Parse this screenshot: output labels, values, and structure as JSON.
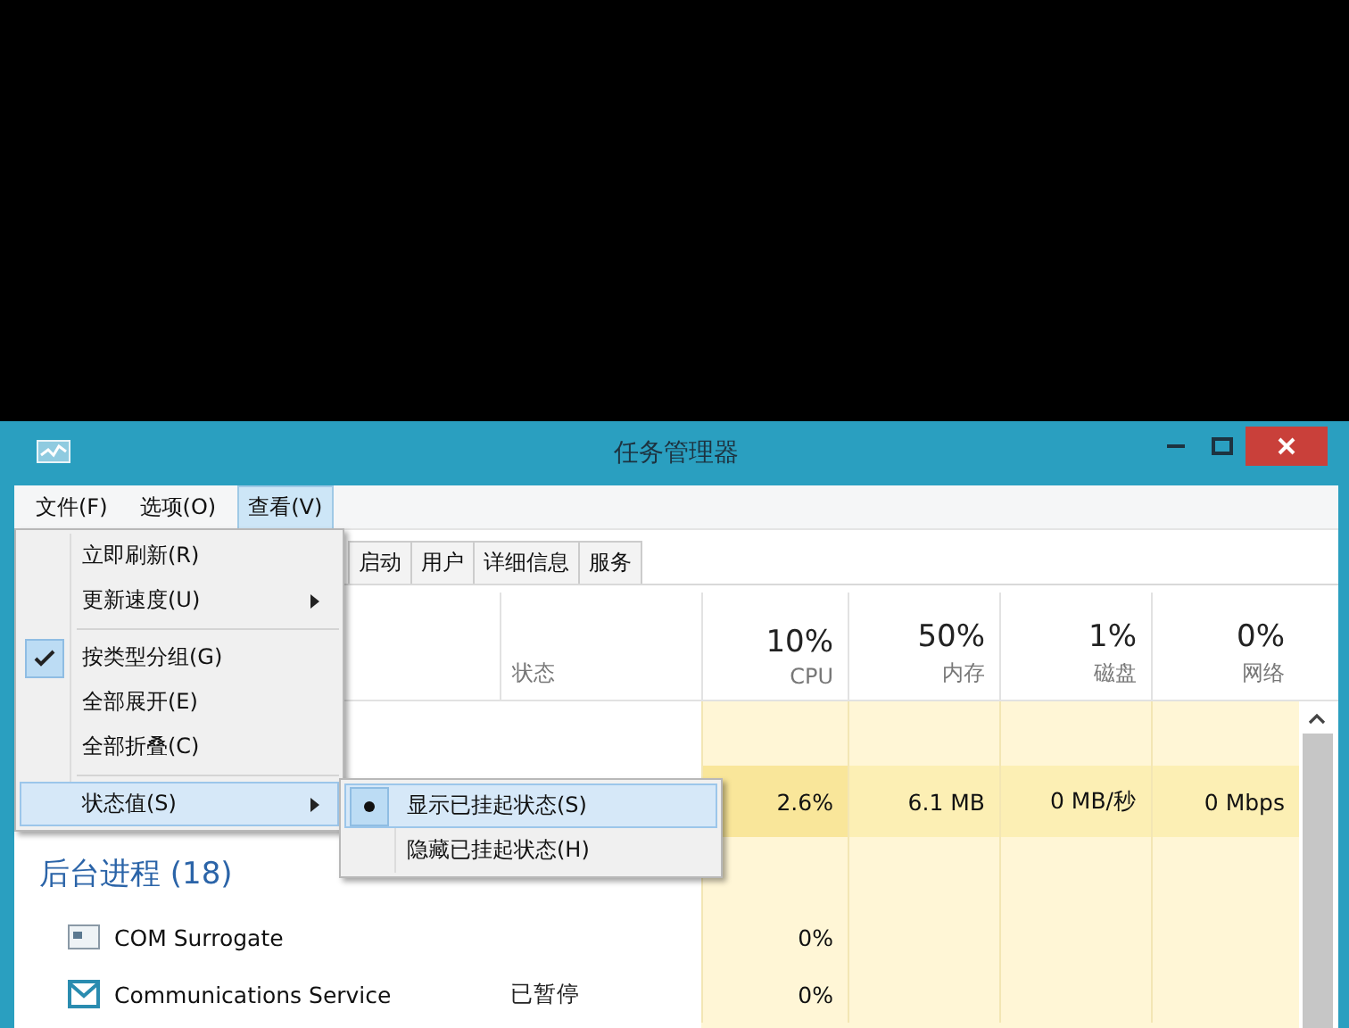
{
  "window": {
    "title": "任务管理器"
  },
  "menu_bar": [
    {
      "label": "文件(F)",
      "selected": false
    },
    {
      "label": "选项(O)",
      "selected": false
    },
    {
      "label": "查看(V)",
      "selected": true
    }
  ],
  "tabs": [
    {
      "label": "启动",
      "selected": false
    },
    {
      "label": "用户",
      "selected": false
    },
    {
      "label": "详细信息",
      "selected": false
    },
    {
      "label": "服务",
      "selected": false
    }
  ],
  "view_menu": {
    "items": [
      {
        "kind": "item",
        "label": "立即刷新(R)",
        "submenu": false,
        "checked": false,
        "selected": false
      },
      {
        "kind": "item",
        "label": "更新速度(U)",
        "submenu": true,
        "checked": false,
        "selected": false
      },
      {
        "kind": "separator"
      },
      {
        "kind": "item",
        "label": "按类型分组(G)",
        "submenu": false,
        "checked": true,
        "selected": false
      },
      {
        "kind": "item",
        "label": "全部展开(E)",
        "submenu": false,
        "checked": false,
        "selected": false
      },
      {
        "kind": "item",
        "label": "全部折叠(C)",
        "submenu": false,
        "checked": false,
        "selected": false
      },
      {
        "kind": "separator"
      },
      {
        "kind": "item",
        "label": "状态值(S)",
        "submenu": true,
        "checked": false,
        "selected": true
      }
    ]
  },
  "submenu": {
    "items": [
      {
        "label": "显示已挂起状态(S)",
        "checked": true,
        "selected": true
      },
      {
        "label": "隐藏已挂起状态(H)",
        "checked": false,
        "selected": false
      }
    ]
  },
  "table": {
    "columns": [
      {
        "label": "状态"
      },
      {
        "percent": "10%",
        "label": "CPU"
      },
      {
        "percent": "50%",
        "label": "内存"
      },
      {
        "percent": "1%",
        "label": "磁盘"
      },
      {
        "percent": "0%",
        "label": "网络"
      }
    ],
    "rows": [
      {
        "kind": "app",
        "cpu": "2.6%",
        "memory": "6.1 MB",
        "disk": "0 MB/秒",
        "network": "0 Mbps"
      },
      {
        "kind": "group",
        "name": "后台进程 (18)"
      },
      {
        "kind": "process",
        "name": "COM Surrogate",
        "cpu": "0%"
      },
      {
        "kind": "process",
        "name": "Communications Service",
        "status": "已暂停",
        "cpu": "0%"
      }
    ]
  }
}
